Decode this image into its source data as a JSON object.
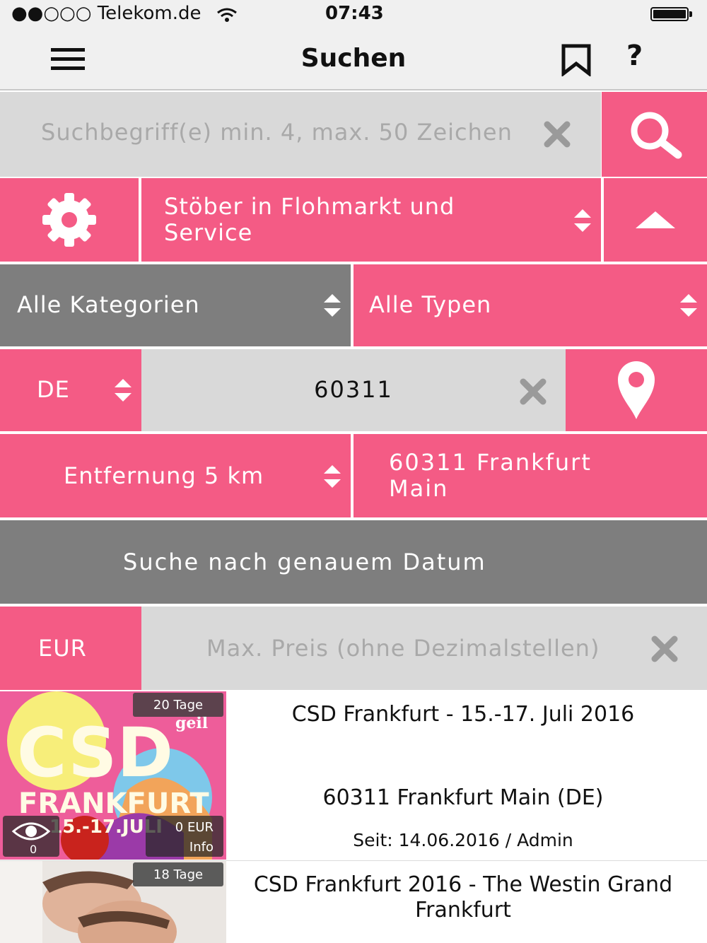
{
  "status_bar": {
    "carrier": "●●○○○ Telekom.de",
    "time": "07:43"
  },
  "header": {
    "title": "Suchen"
  },
  "search": {
    "placeholder": "Suchbegriff(e) min. 4, max. 50 Zeichen"
  },
  "browse": {
    "label": "Stöber in Flohmarkt und Service"
  },
  "filters": {
    "category": "Alle Kategorien",
    "type": "Alle Typen"
  },
  "location": {
    "country": "DE",
    "zip": "60311"
  },
  "distance": {
    "label": "Entfernung 5 km",
    "place": "60311 Frankfurt Main"
  },
  "date_search": {
    "label": "Suche nach genauem Datum"
  },
  "price": {
    "currency": "EUR",
    "placeholder": "Max. Preis (ohne Dezimalstellen)"
  },
  "listings": [
    {
      "days": "20 Tage",
      "title": "CSD Frankfurt - 15.-17. Juli 2016",
      "location": "60311 Frankfurt Main (DE)",
      "meta": "Seit: 14.06.2016 / Admin",
      "views": "0",
      "price": "0 EUR",
      "info": "Info",
      "poster_text": [
        "CSD",
        "FRANKFURT",
        "15.-17.JULI",
        "geil"
      ]
    },
    {
      "days": "18 Tage",
      "title": "CSD Frankfurt 2016 - The Westin Grand Frankfurt"
    }
  ],
  "colors": {
    "accent": "#f45b85",
    "gray": "#7e7e7e",
    "field": "#d9d9d9"
  }
}
